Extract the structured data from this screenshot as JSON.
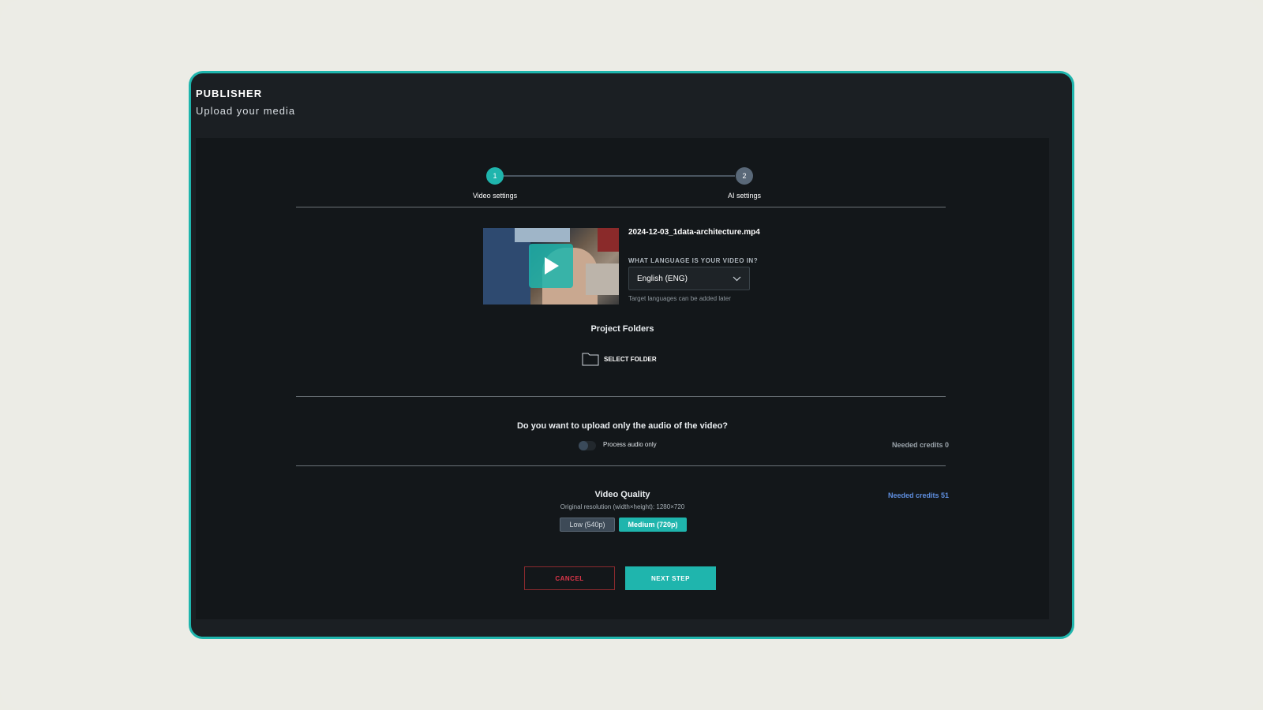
{
  "app": {
    "title": "PUBLISHER",
    "subtitle": "Upload your media"
  },
  "stepper": {
    "steps": [
      {
        "number": "1",
        "label": "Video settings",
        "active": true
      },
      {
        "number": "2",
        "label": "AI settings",
        "active": false
      }
    ]
  },
  "video": {
    "filename": "2024-12-03_1data-architecture.mp4",
    "language_label": "WHAT LANGUAGE IS YOUR VIDEO IN?",
    "language_value": "English (ENG)",
    "language_hint": "Target languages can be added later"
  },
  "folders": {
    "title": "Project Folders",
    "select_label": "SELECT FOLDER"
  },
  "audio": {
    "question": "Do you want to upload only the audio of the video?",
    "toggle_label": "Process audio only",
    "toggle_on": false,
    "credits": "Needed credits 0"
  },
  "quality": {
    "title": "Video Quality",
    "subtitle": "Original resolution (width×height): 1280×720",
    "credits": "Needed credits 51",
    "options": [
      {
        "label": "Low (540p)",
        "selected": false
      },
      {
        "label": "Medium (720p)",
        "selected": true
      }
    ]
  },
  "actions": {
    "cancel": "CANCEL",
    "next": "NEXT STEP"
  },
  "colors": {
    "accent": "#1fb5ad",
    "danger": "#e0364a",
    "credits_link": "#5f8fe0"
  }
}
